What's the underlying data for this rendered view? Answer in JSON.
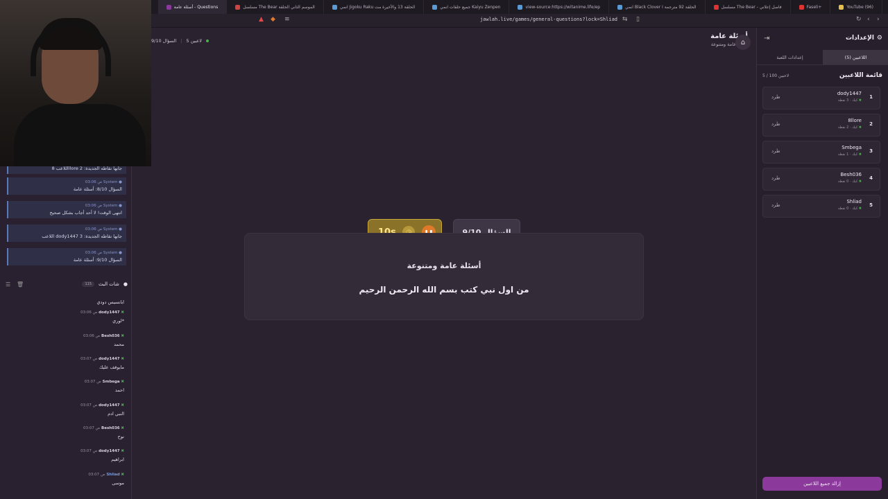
{
  "browser": {
    "tabs": [
      {
        "label": "YouTube (96)",
        "active": false
      },
      {
        "label": "Faseli+",
        "active": false
      },
      {
        "label": "مسلسل The Bear - فاصل إعلاني",
        "active": false
      },
      {
        "label": "انمي Black Clover الحلقة 92 مترجمة ا",
        "active": false
      },
      {
        "label": "view-source:https://witanime.life/ep",
        "active": false
      },
      {
        "label": "جميع حلقات انمي Kaiyu Zenpen",
        "active": false
      },
      {
        "label": "انمي Jigoku Raku الحلقة 13 والأخيرة مت",
        "active": false
      },
      {
        "label": "مسلسل The Bear الموسم الثاني الحلقة",
        "active": false
      },
      {
        "label": "أسئلة عامة - Questions",
        "active": true
      }
    ],
    "url": "jawlah.live/games/general-questions?lock=Shliad"
  },
  "left_panel": {
    "system_messages": [
      {
        "sender": "",
        "time": "",
        "text": "اللاعب 8llore جابها نقاطه الجديدة: 2"
      },
      {
        "sender": "System",
        "time": "03:06 ص",
        "text": "السؤال 8/10: أسئلة عامة"
      },
      {
        "sender": "System",
        "time": "03:06 ص",
        "text": "انتهى الوقت! لا أحد أجاب بشكل صحيح"
      },
      {
        "sender": "System",
        "time": "03:06 ص",
        "text": "اللاعب dody1447 جابها نقاطه الجديدة: 3"
      },
      {
        "sender": "System",
        "time": "03:06 ص",
        "text": "السؤال 9/10: أسئلة عامة"
      }
    ],
    "chat_header": {
      "title": "شات البث",
      "count": "115"
    },
    "chat_messages": [
      {
        "name": "",
        "time": "",
        "text": "ابانسيس دودي"
      },
      {
        "name": "dody1447",
        "time": "03:06 ص",
        "text": "لوري*"
      },
      {
        "name": "Besh036",
        "time": "03:06 ص",
        "text": "محمد"
      },
      {
        "name": "dody1447",
        "time": "03:07 ص",
        "text": "مايوقف عليك"
      },
      {
        "name": "Smbega",
        "time": "03:07 ص",
        "text": "احمد"
      },
      {
        "name": "dody1447",
        "time": "03:07 ص",
        "text": "النبي ادم"
      },
      {
        "name": "Besh036",
        "time": "03:07 ص",
        "text": "نوح"
      },
      {
        "name": "dody1447",
        "time": "03:07 ص",
        "text": "ابراهيم"
      },
      {
        "name": "Shliad",
        "time": "03:07 ص",
        "text": "موسى"
      }
    ]
  },
  "main": {
    "title": "أسئلة عامة",
    "subtitle": "أسئلة عامة ومتنوعة",
    "info_players": "5 لاعبين",
    "info_question": "السؤال 9/10",
    "timer": "10s",
    "question_number": "السؤال 9/10",
    "category": "أسئلة عامة ومتنوعة",
    "question": "من اول نبي كتب بسم الله الرحمن الرحيم"
  },
  "right_panel": {
    "title": "الإعدادات",
    "tabs": [
      {
        "label": "اللاعبين (5)",
        "active": true
      },
      {
        "label": "إعدادات اللعبة",
        "active": false
      }
    ],
    "players_title": "قائمة اللاعبين",
    "players_count": "5 / 100 لاعبين",
    "players": [
      {
        "rank": "1",
        "name": "dody1447",
        "meta": "كيك · 3 نقطة",
        "kick": "طرد"
      },
      {
        "rank": "2",
        "name": "8llore",
        "meta": "كيك · 2 نقطة",
        "kick": "طرد"
      },
      {
        "rank": "3",
        "name": "Smbega",
        "meta": "كيك · 1 نقطة",
        "kick": "طرد"
      },
      {
        "rank": "4",
        "name": "Besh036",
        "meta": "كيك · 0 نقطة",
        "kick": "طرد"
      },
      {
        "rank": "5",
        "name": "Shliad",
        "meta": "كيك · 0 نقطة",
        "kick": "طرد"
      }
    ],
    "remove_all": "إزالة جميع اللاعبين"
  },
  "colors": {
    "accent": "#8b3a9c",
    "timer": "#c8a838",
    "online": "#4caf50"
  }
}
